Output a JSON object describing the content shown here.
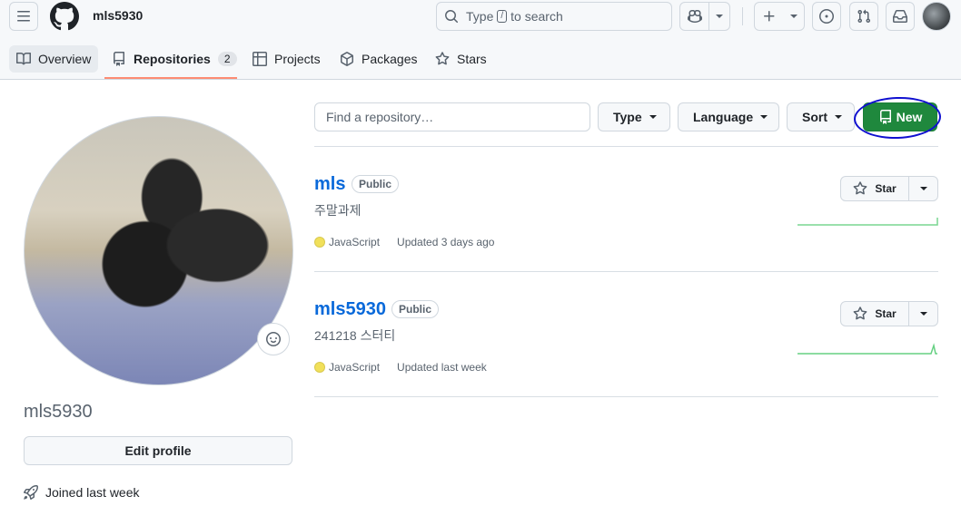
{
  "header": {
    "owner": "mls5930",
    "search": {
      "prefix": "Type",
      "key": "/",
      "suffix": "to search"
    }
  },
  "tabs": [
    {
      "label": "Overview",
      "icon": "book-icon"
    },
    {
      "label": "Repositories",
      "icon": "repo-icon",
      "count": "2"
    },
    {
      "label": "Projects",
      "icon": "table-icon"
    },
    {
      "label": "Packages",
      "icon": "package-icon"
    },
    {
      "label": "Stars",
      "icon": "star-icon"
    }
  ],
  "sidebar": {
    "username": "mls5930",
    "edit_profile": "Edit profile",
    "joined": "Joined last week"
  },
  "toolbar": {
    "find_placeholder": "Find a repository…",
    "type_label": "Type",
    "language_label": "Language",
    "sort_label": "Sort",
    "new_label": "New"
  },
  "repos": [
    {
      "name": "mls",
      "visibility": "Public",
      "description": "주말과제",
      "language": "JavaScript",
      "updated": "Updated 3 days ago",
      "star_label": "Star"
    },
    {
      "name": "mls5930",
      "visibility": "Public",
      "description": "241218 스터티",
      "language": "JavaScript",
      "updated": "Updated last week",
      "star_label": "Star"
    }
  ],
  "colors": {
    "accent_green": "#1f883d",
    "link_blue": "#0969da",
    "tab_underline": "#fd8c73",
    "javascript": "#f1e05a",
    "annotation": "#1010d0"
  }
}
